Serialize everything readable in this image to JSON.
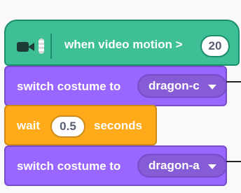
{
  "hat_block": {
    "icon": "video-camera-icon",
    "text": "when video motion >",
    "value": "20"
  },
  "blocks": [
    {
      "label": "switch costume to",
      "dropdown": "dragon-c"
    },
    {
      "label": "wait",
      "value": "0.5",
      "suffix": "seconds"
    },
    {
      "label": "switch costume to",
      "dropdown": "dragon-a"
    }
  ],
  "colors": {
    "event_green": "#3ebf96",
    "looks_purple": "#9966ff",
    "control_orange": "#ffab19"
  }
}
